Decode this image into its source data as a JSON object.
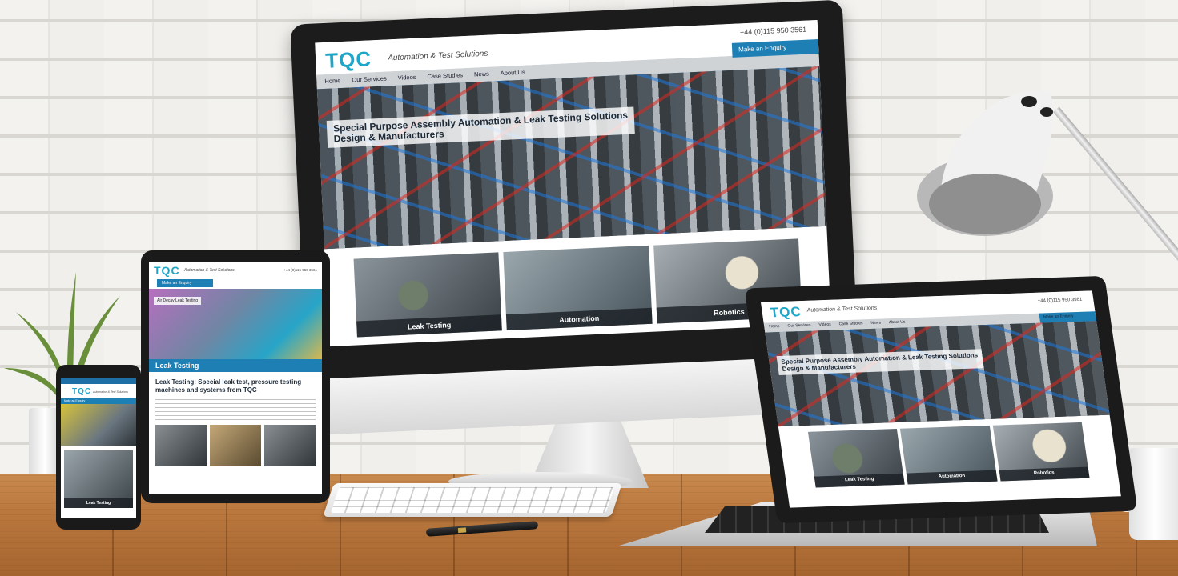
{
  "website": {
    "logo": "TQC",
    "tagline": "Automation & Test Solutions",
    "phone": "+44 (0)115 950 3561",
    "enquiry_button": "Make an Enquiry",
    "nav": [
      "Home",
      "Our Services",
      "Videos",
      "Case Studies",
      "News",
      "About Us"
    ],
    "hero_title_line1": "Special Purpose Assembly Automation & Leak Testing Solutions",
    "hero_title_line2": "Design & Manufacturers",
    "tiles": [
      "Leak Testing",
      "Automation",
      "Robotics"
    ]
  },
  "tablet": {
    "hero_label": "Air Decay Leak Testing",
    "section_bar": "Leak Testing",
    "heading": "Leak Testing: Special leak test, pressure testing machines and systems from TQC"
  },
  "phone": {
    "tile_label": "Leak Testing"
  },
  "colors": {
    "brand_blue": "#1e7fb5",
    "logo_cyan": "#1ea6c8",
    "nav_gray": "#cfd3d6"
  }
}
